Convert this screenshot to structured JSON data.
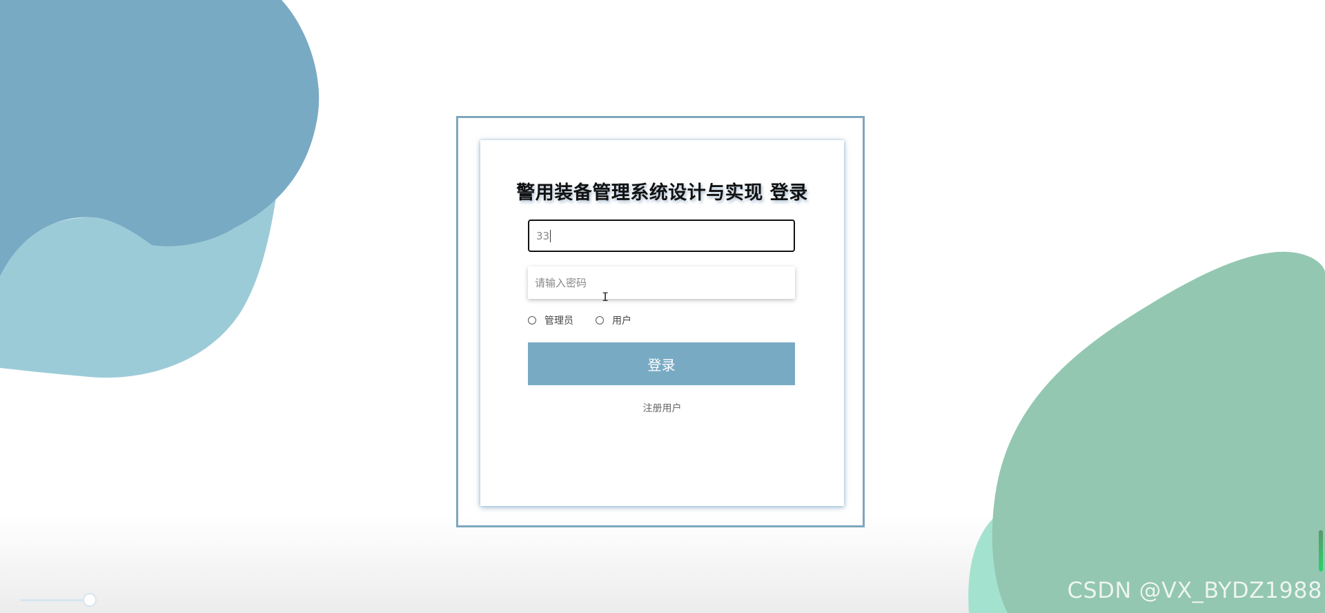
{
  "login": {
    "title": "警用装备管理系统设计与实现 登录",
    "username_value": "33",
    "password_placeholder": "请输入密码",
    "roles": [
      "管理员",
      "用户"
    ],
    "login_button": "登录",
    "register_link": "注册用户"
  },
  "watermark": "CSDN @VX_BYDZ1988",
  "colors": {
    "blob_blue_dark": "#78aac4",
    "blob_blue_light": "#9ccbd8",
    "blob_green": "#93c7b1",
    "blob_mint": "#a4e2d0",
    "frame_border": "#7ea6bd",
    "button_bg": "#78aac4"
  }
}
